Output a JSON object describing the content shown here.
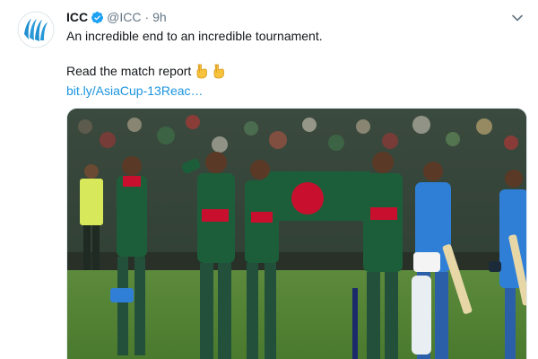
{
  "tweet": {
    "author_name": "ICC",
    "verified": true,
    "handle": "@ICC",
    "separator": "·",
    "time": "9h",
    "line1": "An incredible end to an incredible tournament.",
    "line2": "Read the match report",
    "link": "bit.ly/AsiaCup-13Reac…",
    "emojis": [
      "backhand-index-pointing-down",
      "backhand-index-pointing-down"
    ],
    "media": {
      "description_icon": "match-photo",
      "boundary_text": "",
      "colors": {
        "bangladesh_green": "#1d5e3a",
        "bangladesh_red": "#c8102e",
        "india_blue": "#2f7fd6"
      }
    }
  },
  "colors": {
    "text": "#14171a",
    "secondary": "#657786",
    "link": "#1b95e0",
    "verified": "#1da1f2",
    "emoji": "#f7c23c"
  }
}
